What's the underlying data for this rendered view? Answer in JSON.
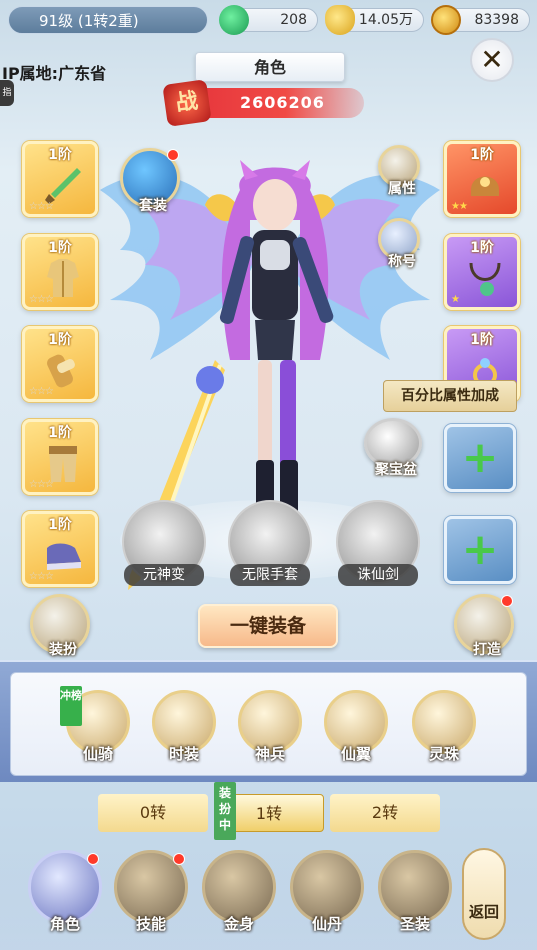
{
  "header": {
    "level": "91级 (1转2重)",
    "location": "IP属地:广东省",
    "side_tab": "指",
    "title": "角色",
    "resources": [
      {
        "name": "jade",
        "icon": "jade-icon",
        "value": "208"
      },
      {
        "name": "ingot",
        "icon": "gold-ingot-icon",
        "value": "14.05万"
      },
      {
        "name": "coin",
        "icon": "coin-icon",
        "value": "83398"
      }
    ],
    "power_label": "战",
    "power_value": "2606206"
  },
  "left_slots": [
    {
      "tier": "1阶",
      "stars": "☆☆☆",
      "item": "sword-icon"
    },
    {
      "tier": "1阶",
      "stars": "☆☆☆",
      "item": "armor-icon"
    },
    {
      "tier": "1阶",
      "stars": "☆☆☆",
      "item": "bracer-icon"
    },
    {
      "tier": "1阶",
      "stars": "☆☆☆",
      "item": "leggings-icon"
    },
    {
      "tier": "1阶",
      "stars": "☆☆☆",
      "item": "boots-icon"
    }
  ],
  "right_slots": [
    {
      "tier": "1阶",
      "stars": "★★",
      "item": "helmet-icon"
    },
    {
      "tier": "1阶",
      "stars": "★",
      "item": "necklace-icon"
    },
    {
      "tier": "1阶",
      "stars": "",
      "item": "ring-icon"
    }
  ],
  "buttons": {
    "suit": "套装",
    "attributes": "属性",
    "title_btn": "称号",
    "treasure": "聚宝盆",
    "treasure_badge": "聚宝盆",
    "dress": "装扮",
    "forge": "打造",
    "one_key_equip": "一键装备",
    "tooltip": "百分比属性加成",
    "add": "+"
  },
  "skills": [
    {
      "label": "元神变",
      "icon": "spirit-transform-icon"
    },
    {
      "label": "无限手套",
      "icon": "infinity-gauntlet-icon"
    },
    {
      "label": "诛仙剑",
      "icon": "zhuxian-sword-icon"
    }
  ],
  "categories": [
    {
      "label": "仙骑",
      "icon": "mount-icon"
    },
    {
      "label": "时装",
      "icon": "costume-icon"
    },
    {
      "label": "神兵",
      "icon": "divine-weapon-icon"
    },
    {
      "label": "仙翼",
      "icon": "wings-icon"
    },
    {
      "label": "灵珠",
      "icon": "spirit-orb-icon"
    }
  ],
  "rank_tag": "冲榜",
  "zhuan_tabs": [
    "0转",
    "1转",
    "2转"
  ],
  "equipped_tag": "装扮中",
  "nav": [
    {
      "label": "角色",
      "icon": "character-icon",
      "badge": true
    },
    {
      "label": "技能",
      "icon": "skill-book-icon",
      "badge": true
    },
    {
      "label": "金身",
      "icon": "golden-body-icon",
      "badge": false
    },
    {
      "label": "仙丹",
      "icon": "elixir-icon",
      "badge": false
    },
    {
      "label": "圣装",
      "icon": "holy-armor-icon",
      "badge": false
    }
  ],
  "back_label": "返回"
}
